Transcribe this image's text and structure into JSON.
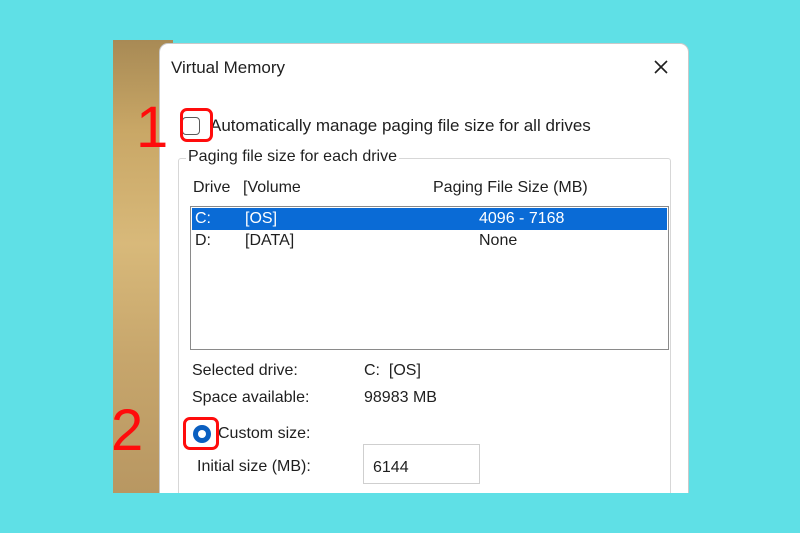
{
  "dialog": {
    "title": "Virtual Memory",
    "close_icon": "close-icon"
  },
  "auto_manage": {
    "label": "Automatically manage paging file size for all drives",
    "checked": false
  },
  "paging_group": {
    "title": "Paging file size for each drive",
    "columns": {
      "drive": "Drive",
      "volume": "[Volume",
      "size": "Paging File Size (MB)"
    },
    "rows": [
      {
        "drive": "C:",
        "volume": "[OS]",
        "size": "4096 - 7168",
        "selected": true
      },
      {
        "drive": "D:",
        "volume": "[DATA]",
        "size": "None",
        "selected": false
      }
    ]
  },
  "selected_drive": {
    "label": "Selected drive:",
    "value": "C:  [OS]"
  },
  "space_available": {
    "label": "Space available:",
    "value": "98983 MB"
  },
  "custom_size": {
    "label": "Custom size:",
    "selected": true
  },
  "initial_size": {
    "label": "Initial size (MB):",
    "value": "6144"
  },
  "annotations": {
    "step1": "1",
    "step2": "2"
  },
  "colors": {
    "background": "#5fe0e6",
    "selection": "#0a6bd6",
    "annotation": "#ff0c0c",
    "radio": "#0a5fc0"
  }
}
